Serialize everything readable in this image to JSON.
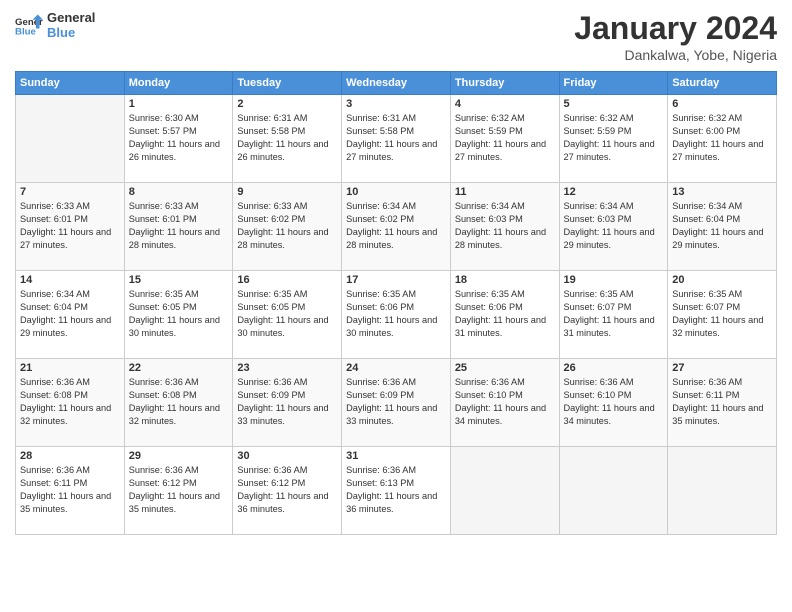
{
  "logo": {
    "general": "General",
    "blue": "Blue"
  },
  "header": {
    "month": "January 2024",
    "location": "Dankalwa, Yobe, Nigeria"
  },
  "weekdays": [
    "Sunday",
    "Monday",
    "Tuesday",
    "Wednesday",
    "Thursday",
    "Friday",
    "Saturday"
  ],
  "weeks": [
    [
      {
        "day": "",
        "sunrise": "",
        "sunset": "",
        "daylight": ""
      },
      {
        "day": "1",
        "sunrise": "Sunrise: 6:30 AM",
        "sunset": "Sunset: 5:57 PM",
        "daylight": "Daylight: 11 hours and 26 minutes."
      },
      {
        "day": "2",
        "sunrise": "Sunrise: 6:31 AM",
        "sunset": "Sunset: 5:58 PM",
        "daylight": "Daylight: 11 hours and 26 minutes."
      },
      {
        "day": "3",
        "sunrise": "Sunrise: 6:31 AM",
        "sunset": "Sunset: 5:58 PM",
        "daylight": "Daylight: 11 hours and 27 minutes."
      },
      {
        "day": "4",
        "sunrise": "Sunrise: 6:32 AM",
        "sunset": "Sunset: 5:59 PM",
        "daylight": "Daylight: 11 hours and 27 minutes."
      },
      {
        "day": "5",
        "sunrise": "Sunrise: 6:32 AM",
        "sunset": "Sunset: 5:59 PM",
        "daylight": "Daylight: 11 hours and 27 minutes."
      },
      {
        "day": "6",
        "sunrise": "Sunrise: 6:32 AM",
        "sunset": "Sunset: 6:00 PM",
        "daylight": "Daylight: 11 hours and 27 minutes."
      }
    ],
    [
      {
        "day": "7",
        "sunrise": "Sunrise: 6:33 AM",
        "sunset": "Sunset: 6:01 PM",
        "daylight": "Daylight: 11 hours and 27 minutes."
      },
      {
        "day": "8",
        "sunrise": "Sunrise: 6:33 AM",
        "sunset": "Sunset: 6:01 PM",
        "daylight": "Daylight: 11 hours and 28 minutes."
      },
      {
        "day": "9",
        "sunrise": "Sunrise: 6:33 AM",
        "sunset": "Sunset: 6:02 PM",
        "daylight": "Daylight: 11 hours and 28 minutes."
      },
      {
        "day": "10",
        "sunrise": "Sunrise: 6:34 AM",
        "sunset": "Sunset: 6:02 PM",
        "daylight": "Daylight: 11 hours and 28 minutes."
      },
      {
        "day": "11",
        "sunrise": "Sunrise: 6:34 AM",
        "sunset": "Sunset: 6:03 PM",
        "daylight": "Daylight: 11 hours and 28 minutes."
      },
      {
        "day": "12",
        "sunrise": "Sunrise: 6:34 AM",
        "sunset": "Sunset: 6:03 PM",
        "daylight": "Daylight: 11 hours and 29 minutes."
      },
      {
        "day": "13",
        "sunrise": "Sunrise: 6:34 AM",
        "sunset": "Sunset: 6:04 PM",
        "daylight": "Daylight: 11 hours and 29 minutes."
      }
    ],
    [
      {
        "day": "14",
        "sunrise": "Sunrise: 6:34 AM",
        "sunset": "Sunset: 6:04 PM",
        "daylight": "Daylight: 11 hours and 29 minutes."
      },
      {
        "day": "15",
        "sunrise": "Sunrise: 6:35 AM",
        "sunset": "Sunset: 6:05 PM",
        "daylight": "Daylight: 11 hours and 30 minutes."
      },
      {
        "day": "16",
        "sunrise": "Sunrise: 6:35 AM",
        "sunset": "Sunset: 6:05 PM",
        "daylight": "Daylight: 11 hours and 30 minutes."
      },
      {
        "day": "17",
        "sunrise": "Sunrise: 6:35 AM",
        "sunset": "Sunset: 6:06 PM",
        "daylight": "Daylight: 11 hours and 30 minutes."
      },
      {
        "day": "18",
        "sunrise": "Sunrise: 6:35 AM",
        "sunset": "Sunset: 6:06 PM",
        "daylight": "Daylight: 11 hours and 31 minutes."
      },
      {
        "day": "19",
        "sunrise": "Sunrise: 6:35 AM",
        "sunset": "Sunset: 6:07 PM",
        "daylight": "Daylight: 11 hours and 31 minutes."
      },
      {
        "day": "20",
        "sunrise": "Sunrise: 6:35 AM",
        "sunset": "Sunset: 6:07 PM",
        "daylight": "Daylight: 11 hours and 32 minutes."
      }
    ],
    [
      {
        "day": "21",
        "sunrise": "Sunrise: 6:36 AM",
        "sunset": "Sunset: 6:08 PM",
        "daylight": "Daylight: 11 hours and 32 minutes."
      },
      {
        "day": "22",
        "sunrise": "Sunrise: 6:36 AM",
        "sunset": "Sunset: 6:08 PM",
        "daylight": "Daylight: 11 hours and 32 minutes."
      },
      {
        "day": "23",
        "sunrise": "Sunrise: 6:36 AM",
        "sunset": "Sunset: 6:09 PM",
        "daylight": "Daylight: 11 hours and 33 minutes."
      },
      {
        "day": "24",
        "sunrise": "Sunrise: 6:36 AM",
        "sunset": "Sunset: 6:09 PM",
        "daylight": "Daylight: 11 hours and 33 minutes."
      },
      {
        "day": "25",
        "sunrise": "Sunrise: 6:36 AM",
        "sunset": "Sunset: 6:10 PM",
        "daylight": "Daylight: 11 hours and 34 minutes."
      },
      {
        "day": "26",
        "sunrise": "Sunrise: 6:36 AM",
        "sunset": "Sunset: 6:10 PM",
        "daylight": "Daylight: 11 hours and 34 minutes."
      },
      {
        "day": "27",
        "sunrise": "Sunrise: 6:36 AM",
        "sunset": "Sunset: 6:11 PM",
        "daylight": "Daylight: 11 hours and 35 minutes."
      }
    ],
    [
      {
        "day": "28",
        "sunrise": "Sunrise: 6:36 AM",
        "sunset": "Sunset: 6:11 PM",
        "daylight": "Daylight: 11 hours and 35 minutes."
      },
      {
        "day": "29",
        "sunrise": "Sunrise: 6:36 AM",
        "sunset": "Sunset: 6:12 PM",
        "daylight": "Daylight: 11 hours and 35 minutes."
      },
      {
        "day": "30",
        "sunrise": "Sunrise: 6:36 AM",
        "sunset": "Sunset: 6:12 PM",
        "daylight": "Daylight: 11 hours and 36 minutes."
      },
      {
        "day": "31",
        "sunrise": "Sunrise: 6:36 AM",
        "sunset": "Sunset: 6:13 PM",
        "daylight": "Daylight: 11 hours and 36 minutes."
      },
      {
        "day": "",
        "sunrise": "",
        "sunset": "",
        "daylight": ""
      },
      {
        "day": "",
        "sunrise": "",
        "sunset": "",
        "daylight": ""
      },
      {
        "day": "",
        "sunrise": "",
        "sunset": "",
        "daylight": ""
      }
    ]
  ]
}
